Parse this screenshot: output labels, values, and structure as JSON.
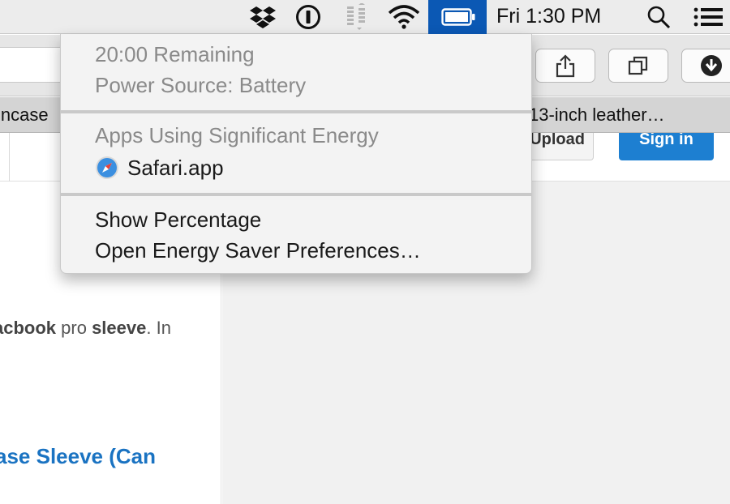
{
  "menubar": {
    "clock": "Fri 1:30 PM",
    "icons": [
      "dropbox-icon",
      "1password-icon",
      "network-activity-icon",
      "wifi-icon",
      "battery-icon",
      "spotlight-search-icon",
      "notification-center-icon"
    ]
  },
  "toolbar": {
    "buttons": [
      "share-icon",
      "tab-overview-icon",
      "downloads-icon"
    ]
  },
  "tabs": {
    "left_title": "incase",
    "right_title": "13-inch leather…"
  },
  "page": {
    "upload_label": "Upload",
    "signin_label": "Sign in",
    "snippet": {
      "bold1": "acbook",
      "text1": " pro ",
      "bold2": "sleeve",
      "text2": ". In"
    },
    "result_link": "ase Sleeve (Can"
  },
  "battery_menu": {
    "remaining": "20:00 Remaining",
    "power_source": "Power Source: Battery",
    "apps_heading": "Apps Using Significant Energy",
    "app_name": "Safari.app",
    "show_percentage": "Show Percentage",
    "energy_saver": "Open Energy Saver Preferences…"
  },
  "colors": {
    "menubar_bg": "#ececec",
    "battery_highlight": "#0b58b4",
    "signin_blue": "#1d7fd1",
    "link_blue": "#1a73c2",
    "menu_bg": "#f3f3f3",
    "disabled_text": "#8a8a8a"
  }
}
